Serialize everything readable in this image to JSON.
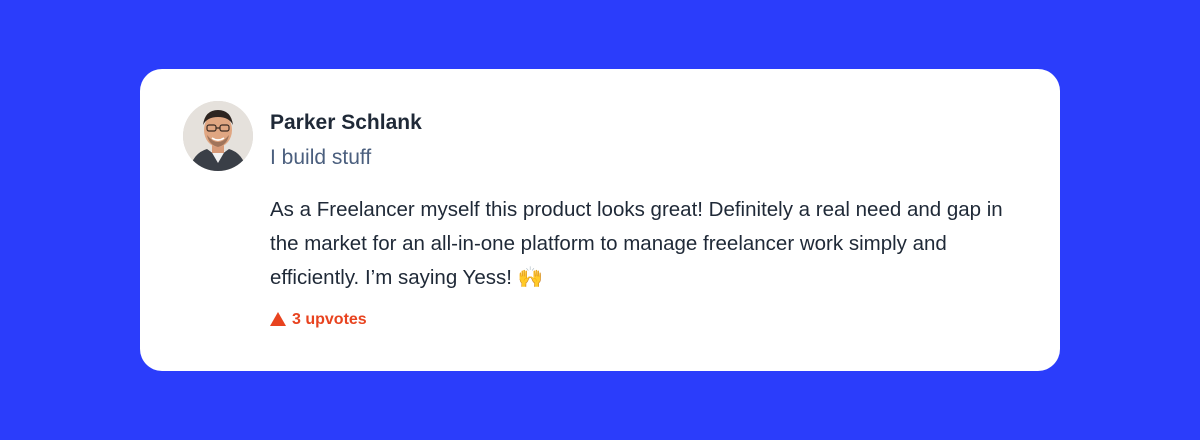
{
  "comment": {
    "author": {
      "name": "Parker Schlank",
      "tagline": "I build stuff",
      "avatar_icon": "user-avatar"
    },
    "body": "As a Freelancer myself this product looks great! Definitely a real need and gap in the market for an all-in-one platform to manage freelancer work simply and efficiently. I’m saying Yess! 🙌",
    "upvotes_label": "3 upvotes",
    "upvote_icon": "triangle-up-icon"
  },
  "colors": {
    "background": "#2b3dfb",
    "card": "#ffffff",
    "upvote": "#e8431f",
    "name": "#1f2937",
    "tagline": "#4b5f7e"
  }
}
